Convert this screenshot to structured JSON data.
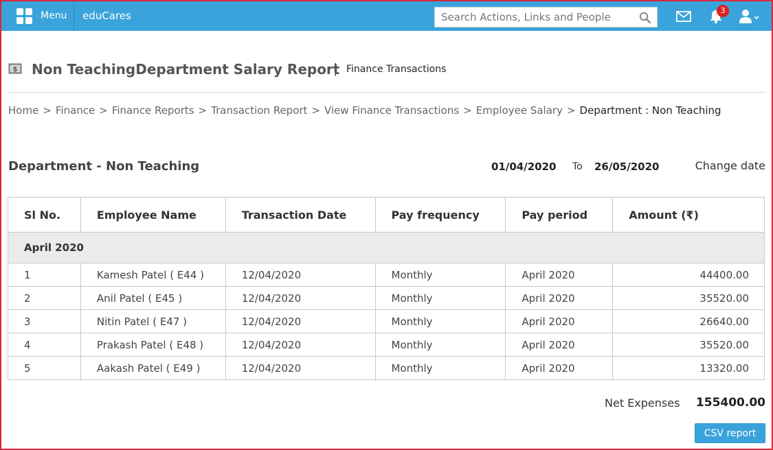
{
  "topbar": {
    "menu_label": "Menu",
    "brand": "eduCares",
    "search_placeholder": "Search Actions, Links and People",
    "notification_count": "3",
    "bar_color": "#3aa3db"
  },
  "header": {
    "title": "Non TeachingDepartment Salary Report",
    "separator": "|",
    "subtitle": "Finance Transactions"
  },
  "breadcrumb": {
    "items": [
      "Home",
      "Finance",
      "Finance Reports",
      "Transaction Report",
      "View Finance Transactions",
      "Employee Salary"
    ],
    "separator": ">",
    "current": "Department : Non Teaching"
  },
  "section": {
    "title": "Department - Non Teaching",
    "date_from": "01/04/2020",
    "to_label": "To",
    "date_to": "26/05/2020",
    "change_date": "Change date"
  },
  "table": {
    "columns": [
      "Sl No.",
      "Employee Name",
      "Transaction Date",
      "Pay frequency",
      "Pay period",
      "Amount (₹)"
    ],
    "group_label": "April 2020",
    "rows": [
      [
        "1",
        "Kamesh Patel ( E44 )",
        "12/04/2020",
        "Monthly",
        "April 2020",
        "44400.00"
      ],
      [
        "2",
        "Anil Patel ( E45 )",
        "12/04/2020",
        "Monthly",
        "April 2020",
        "35520.00"
      ],
      [
        "3",
        "Nitin Patel ( E47 )",
        "12/04/2020",
        "Monthly",
        "April 2020",
        "26640.00"
      ],
      [
        "4",
        "Prakash Patel ( E48 )",
        "12/04/2020",
        "Monthly",
        "April 2020",
        "35520.00"
      ],
      [
        "5",
        "Aakash Patel ( E49 )",
        "12/04/2020",
        "Monthly",
        "April 2020",
        "13320.00"
      ]
    ]
  },
  "footer": {
    "net_label": "Net Expenses",
    "net_value": "155400.00",
    "csv_button": "CSV report"
  }
}
